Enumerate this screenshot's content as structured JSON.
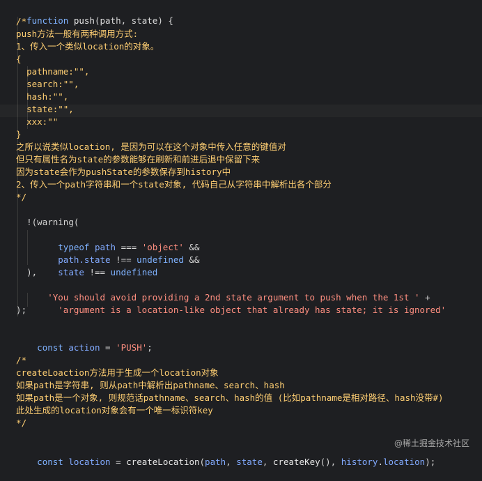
{
  "code": {
    "lines": [
      "function push(path, state) {",
      "  /*",
      "  push方法一般有两种调用方式:",
      "  1、传入一个类似location的对象。",
      "  {",
      "    pathname:\"\",",
      "    search:\"\",",
      "    hash:\"\",",
      "    state:\"\",",
      "    xxx:\"\"",
      "  }",
      "  之所以说类似location, 是因为可以在这个对象中传入任意的键值对",
      "  但只有属性名为state的参数能够在刷新和前进后退中保留下来",
      "  因为state会作为pushState的参数保存到history中",
      "  2、传入一个path字符串和一个state对象, 代码自己从字符串中解析出各个部分",
      "  */",
      "  warning(",
      "    !(",
      "      typeof path === 'object' &&",
      "      path.state !== undefined &&",
      "      state !== undefined",
      "    ),",
      "    'You should avoid providing a 2nd state argument to push when the 1st ' +",
      "      'argument is a location-like object that already has state; it is ignored'",
      "  );",
      "",
      "  const action = 'PUSH';",
      "",
      "  /*",
      "  createLoaction方法用于生成一个location对象",
      "  如果path是字符串, 则从path中解析出pathname、search、hash",
      "  如果path是一个对象, 则规范话pathname、search、hash的值 (比如pathname是相对路径、hash没带#)",
      "  此处生成的location对象会有一个唯一标识符key",
      "  */",
      "",
      "  const location = createLocation(path, state, createKey(), history.location);"
    ]
  },
  "tokens": {
    "function_kw": "function",
    "fn_name": "push",
    "open_paren": "(",
    "param1": "path",
    "comma_space": ", ",
    "param2": "state",
    "close_brace_line": ") {",
    "warning_call": "warning(",
    "typeof_kw": "typeof",
    "path_id": "path",
    "strict_eq": "===",
    "str_object": "'object'",
    "and_op": "&&",
    "path_state": "path.state",
    "strict_neq": "!==",
    "undefined_kw": "undefined",
    "state_id": "state",
    "str_avoid": "'You should avoid providing a 2nd state argument to push when the 1st '",
    "plus_op": "+",
    "str_argument": "'argument is a location-like object that already has state; it is ignored'",
    "const_kw": "const",
    "action_id": "action",
    "eq_op": "=",
    "str_push": "'PUSH'",
    "location_id": "location",
    "create_location": "createLocation",
    "create_key": "createKey",
    "history_id": "history",
    "location_prop": "location"
  },
  "watermark": "@稀土掘金技术社区",
  "colors": {
    "background": "#1e1f22",
    "keyword": "#c792ea",
    "identifier": "#82aaff",
    "string": "#ff8f80",
    "comment": "#ffcf73",
    "text": "#d6d6d6"
  }
}
